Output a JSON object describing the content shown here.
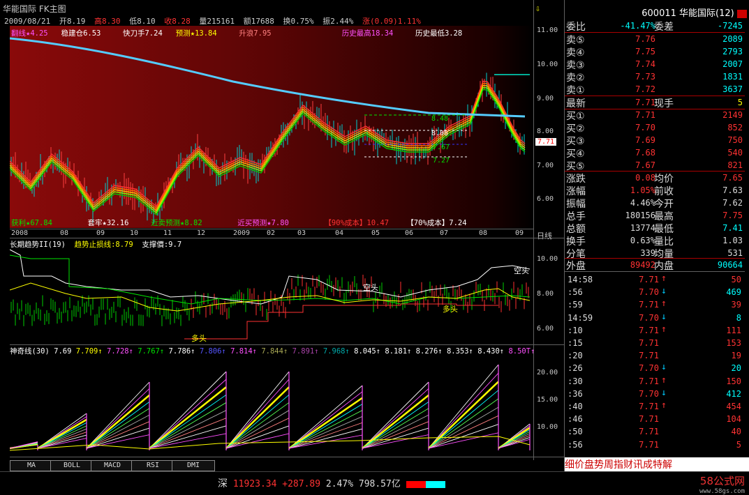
{
  "title": "华能国际 FK主图",
  "ohlc": {
    "date": "2009/08/21",
    "open": "开8.19",
    "high": "高8.30",
    "low": "低8.10",
    "close": "收8.28",
    "volume": "量215161",
    "amount": "额17688",
    "turnover": "换0.75%",
    "amplitude": "振2.44%",
    "change": "涨(0.09)1.11%"
  },
  "main_indicators": {
    "line1": [
      "翻线★4.25",
      "稳建仓6.53",
      "快刀手7.24",
      "预测★13.84",
      "升浪7.95",
      "历史最高18.34",
      "历史最低3.28"
    ],
    "line2": [
      "获利★67.84",
      "套牢★32.16",
      "近卖预测★8.82",
      "近买预测★7.80",
      "【90%成本】10.47",
      "【70%成本】7.24"
    ]
  },
  "chart_labels": {
    "p848": "8.48",
    "p808": "8.08",
    "p767": "7.67",
    "p727": "7.27",
    "current_price_tag": "7.71"
  },
  "main_axis": [
    "11.00",
    "10.00",
    "9.00",
    "8.00",
    "7.00",
    "6.00"
  ],
  "dates": [
    "2008",
    "08",
    "09",
    "10",
    "11",
    "12",
    "2009",
    "02",
    "03",
    "04",
    "05",
    "06",
    "07",
    "08",
    "09"
  ],
  "period": "日线",
  "sub1": {
    "title": "长期趋势II(19)",
    "stop": "趋势止损线:8.79",
    "support": "支撑價:9.7",
    "axis": [
      "10.00",
      "8.00",
      "6.00"
    ],
    "labels": {
      "kong": "空头",
      "duo": "多头"
    }
  },
  "sub2": {
    "title": "神奇线(30)",
    "values": [
      "7.69",
      "7.709↑",
      "7.728↑",
      "7.767↑",
      "7.786↑",
      "7.806↑",
      "7.814↑",
      "7.844↑",
      "7.891↑",
      "7.968↑",
      "8.045↑",
      "8.181↑",
      "8.276↑",
      "8.353↑",
      "8.430↑",
      "8.50T↑"
    ],
    "axis": [
      "20.00",
      "15.00",
      "10.00"
    ]
  },
  "tabs": [
    "MA",
    "BOLL",
    "MACD",
    "RSI",
    "DMI"
  ],
  "quote": {
    "header": "600011 华能国际(12)",
    "weibi": {
      "label": "委比",
      "value": "-41.47%",
      "label2": "委差",
      "value2": "-7245"
    },
    "asks": [
      {
        "label": "卖⑤",
        "price": "7.76",
        "vol": "2089"
      },
      {
        "label": "卖④",
        "price": "7.75",
        "vol": "2793"
      },
      {
        "label": "卖③",
        "price": "7.74",
        "vol": "2007"
      },
      {
        "label": "卖②",
        "price": "7.73",
        "vol": "1831"
      },
      {
        "label": "卖①",
        "price": "7.72",
        "vol": "3637"
      }
    ],
    "latest": {
      "label": "最新",
      "value": "7.71",
      "label2": "现手",
      "value2": "5"
    },
    "bids": [
      {
        "label": "买①",
        "price": "7.71",
        "vol": "2149"
      },
      {
        "label": "买②",
        "price": "7.70",
        "vol": "852"
      },
      {
        "label": "买③",
        "price": "7.69",
        "vol": "750"
      },
      {
        "label": "买④",
        "price": "7.68",
        "vol": "540"
      },
      {
        "label": "买⑤",
        "price": "7.67",
        "vol": "821"
      }
    ],
    "stats": [
      {
        "l1": "涨跌",
        "v1": "0.08",
        "l2": "均价",
        "v2": "7.65"
      },
      {
        "l1": "涨幅",
        "v1": "1.05%",
        "l2": "前收",
        "v2": "7.63"
      },
      {
        "l1": "振幅",
        "v1": "4.46%",
        "l2": "今开",
        "v2": "7.62"
      },
      {
        "l1": "总手",
        "v1": "180156",
        "l2": "最高",
        "v2": "7.75"
      },
      {
        "l1": "总额",
        "v1": "13774",
        "l2": "最低",
        "v2": "7.41"
      },
      {
        "l1": "换手",
        "v1": "0.63%",
        "l2": "量比",
        "v2": "1.03"
      },
      {
        "l1": "分笔",
        "v1": "339",
        "l2": "均量",
        "v2": "531"
      }
    ],
    "outer": {
      "l1": "外盘",
      "v1": "89492",
      "l2": "内盘",
      "v2": "90664"
    }
  },
  "ticks": [
    {
      "time": "14:58",
      "price": "7.71",
      "dir": "up",
      "vol": "50"
    },
    {
      "time": ":56",
      "price": "7.70",
      "dir": "down",
      "vol": "469"
    },
    {
      "time": ":59",
      "price": "7.71",
      "dir": "up",
      "vol": "39"
    },
    {
      "time": "14:59",
      "price": "7.70",
      "dir": "down",
      "vol": "8"
    },
    {
      "time": ":10",
      "price": "7.71",
      "dir": "up",
      "vol": "111"
    },
    {
      "time": ":15",
      "price": "7.71",
      "dir": "",
      "vol": "153"
    },
    {
      "time": ":20",
      "price": "7.71",
      "dir": "",
      "vol": "19"
    },
    {
      "time": ":26",
      "price": "7.70",
      "dir": "down",
      "vol": "20"
    },
    {
      "time": ":30",
      "price": "7.71",
      "dir": "up",
      "vol": "150"
    },
    {
      "time": ":36",
      "price": "7.70",
      "dir": "down",
      "vol": "412"
    },
    {
      "time": ":40",
      "price": "7.71",
      "dir": "up",
      "vol": "454"
    },
    {
      "time": ":46",
      "price": "7.71",
      "dir": "",
      "vol": "104"
    },
    {
      "time": ":50",
      "price": "7.71",
      "dir": "",
      "vol": "40"
    },
    {
      "time": ":56",
      "price": "7.71",
      "dir": "",
      "vol": "5"
    }
  ],
  "bottom_tabs": "细价盘势周指财讯成特解",
  "status": {
    "market": "深",
    "index": "11923.34",
    "change": "+287.89",
    "pct": "2.47%",
    "amount": "798.57亿"
  },
  "watermark": {
    "brand": "58公式网",
    "url": "www.58gs.com"
  }
}
